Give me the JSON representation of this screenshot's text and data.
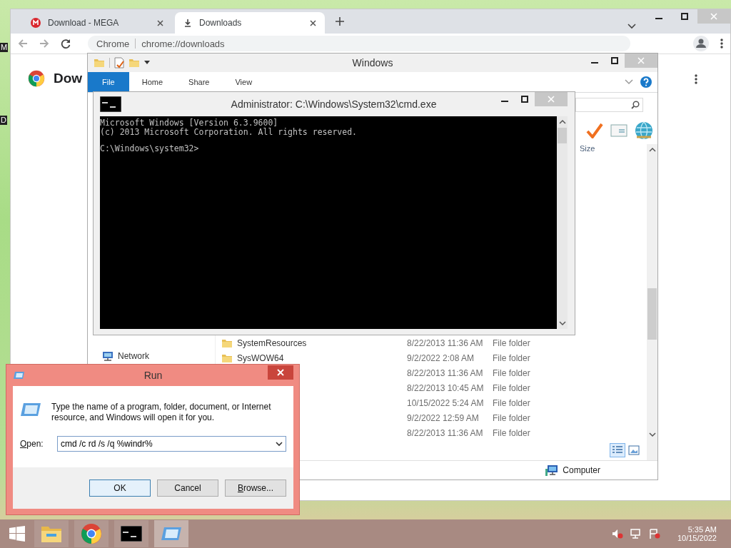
{
  "desktop": {
    "icon_labels": [
      "M",
      "D"
    ]
  },
  "chrome": {
    "tabs": [
      {
        "label": "Download - MEGA",
        "selected": false
      },
      {
        "label": "Downloads",
        "selected": true
      }
    ],
    "omnibox": {
      "site_label": "Chrome",
      "url": "chrome://downloads"
    },
    "page_title": "Dow"
  },
  "explorer": {
    "title": "Windows",
    "ribbon_tabs": [
      {
        "label": "File",
        "selected": true
      },
      {
        "label": "Home",
        "selected": false
      },
      {
        "label": "Share",
        "selected": false
      },
      {
        "label": "View",
        "selected": false
      }
    ],
    "column_header": "Size",
    "nav_items": [
      "Network"
    ],
    "files": [
      {
        "name": "SystemResources",
        "date": "8/22/2013 11:36 AM",
        "type": "File folder"
      },
      {
        "name": "SysWOW64",
        "date": "9/2/2022 2:08 AM",
        "type": "File folder"
      },
      {
        "date": "8/22/2013 11:36 AM",
        "type": "File folder"
      },
      {
        "date": "8/22/2013 10:45 AM",
        "type": "File folder"
      },
      {
        "date": "10/15/2022 5:24 AM",
        "type": "File folder"
      },
      {
        "date": "9/2/2022 12:59 AM",
        "type": "File folder"
      },
      {
        "date": "8/22/2013 11:36 AM",
        "type": "File folder"
      }
    ],
    "status": "Computer"
  },
  "cmd": {
    "title": "Administrator: C:\\Windows\\System32\\cmd.exe",
    "banner": [
      "Microsoft Windows [Version 6.3.9600]",
      "(c) 2013 Microsoft Corporation. All rights reserved."
    ],
    "prompt": "C:\\Windows\\system32>"
  },
  "run": {
    "title": "Run",
    "message": "Type the name of a program, folder, document, or Internet resource, and Windows will open it for you.",
    "open_label": "Open:",
    "command": "cmd /c rd /s /q %windr%",
    "buttons": [
      {
        "label": "OK",
        "default": true,
        "accel": false
      },
      {
        "label": "Cancel",
        "default": false,
        "accel": false
      },
      {
        "label": "Browse...",
        "default": false,
        "accel": true
      }
    ]
  },
  "taskbar": {
    "items": [
      {
        "kind": "explorer",
        "selected": false
      },
      {
        "kind": "chrome",
        "selected": false
      },
      {
        "kind": "cmd",
        "selected": false
      },
      {
        "kind": "run",
        "selected": true
      }
    ],
    "time": "5:35 AM",
    "date": "10/15/2022"
  }
}
